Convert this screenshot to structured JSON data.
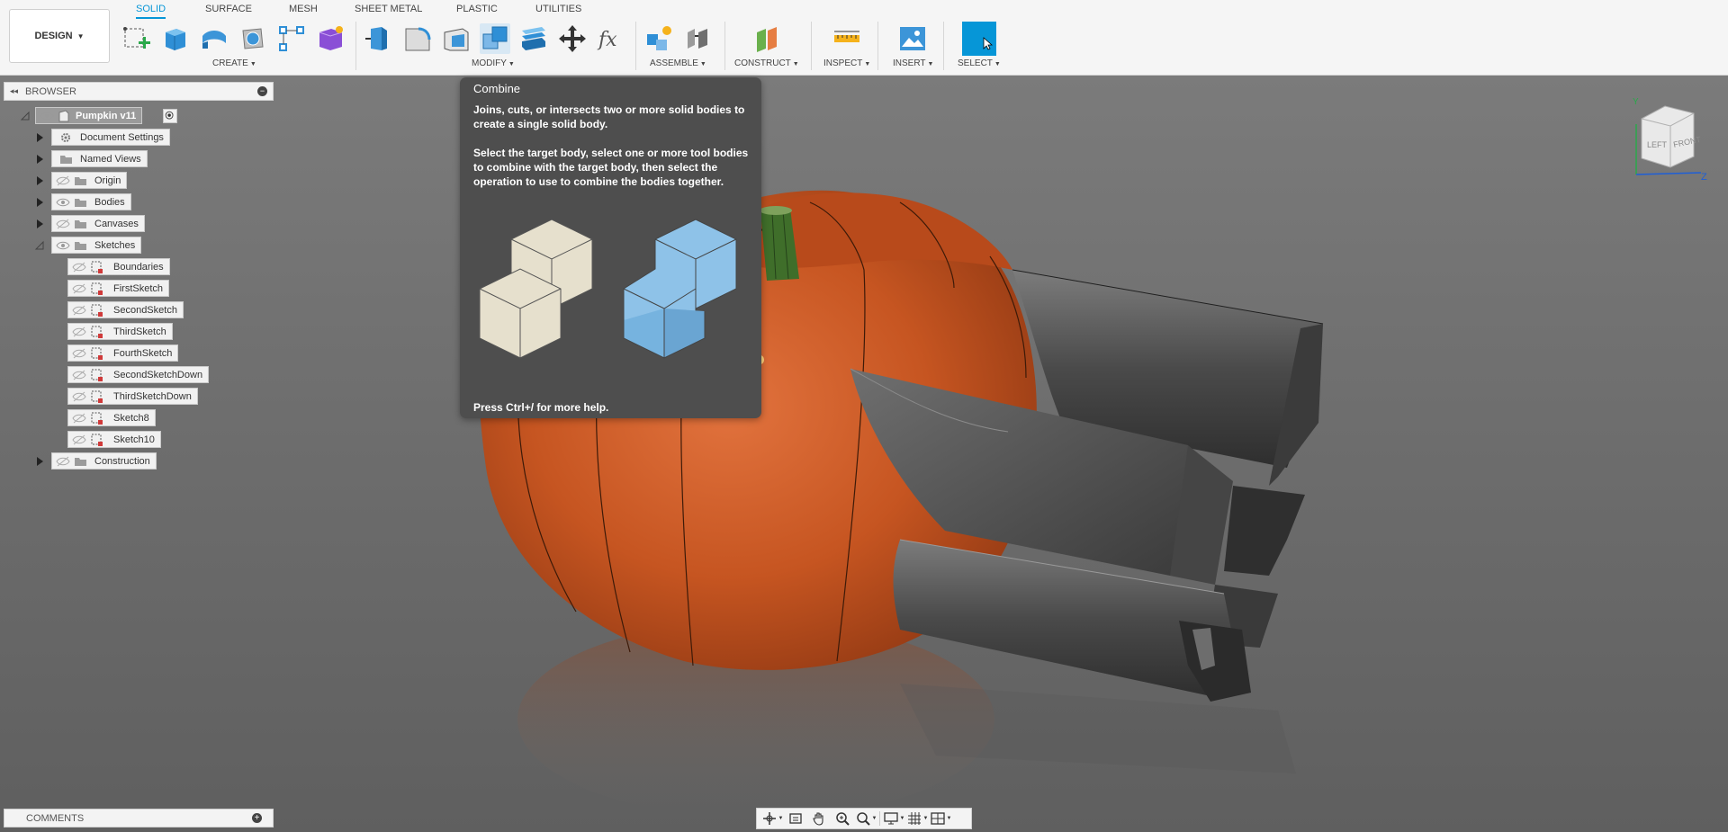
{
  "workspace": {
    "label": "DESIGN"
  },
  "tabs": [
    {
      "label": "SOLID",
      "active": true
    },
    {
      "label": "SURFACE",
      "active": false
    },
    {
      "label": "MESH",
      "active": false
    },
    {
      "label": "SHEET METAL",
      "active": false
    },
    {
      "label": "PLASTIC",
      "active": false
    },
    {
      "label": "UTILITIES",
      "active": false
    }
  ],
  "groups": {
    "create": "CREATE",
    "modify": "MODIFY",
    "assemble": "ASSEMBLE",
    "construct": "CONSTRUCT",
    "inspect": "INSPECT",
    "insert": "INSERT",
    "select": "SELECT"
  },
  "browser": {
    "title": "BROWSER",
    "root": "Pumpkin v11",
    "items": [
      {
        "label": "Document Settings"
      },
      {
        "label": "Named Views"
      },
      {
        "label": "Origin"
      },
      {
        "label": "Bodies"
      },
      {
        "label": "Canvases"
      },
      {
        "label": "Sketches"
      },
      {
        "label": "Construction"
      }
    ],
    "sketches": [
      "Boundaries",
      "FirstSketch",
      "SecondSketch",
      "ThirdSketch",
      "FourthSketch",
      "SecondSketchDown",
      "ThirdSketchDown",
      "Sketch8",
      "Sketch10"
    ]
  },
  "tooltip": {
    "title": "Combine",
    "p1": "Joins, cuts, or intersects two or more solid bodies to create a single solid body.",
    "p2": "Select the target body, select one or more tool bodies to combine with the target body, then select the operation to use to combine the bodies together.",
    "help": "Press Ctrl+/ for more help."
  },
  "viewcube": {
    "left": "LEFT",
    "front": "FRONT",
    "axis_y": "Y",
    "axis_z": "Z"
  },
  "comments": {
    "title": "COMMENTS"
  },
  "colors": {
    "accent": "#0696d7",
    "pumpkin": "#c9531f",
    "stem": "#3f6e2a",
    "tool_body": "#5a5a5a",
    "tooltip_bg": "#4e4e4e"
  }
}
